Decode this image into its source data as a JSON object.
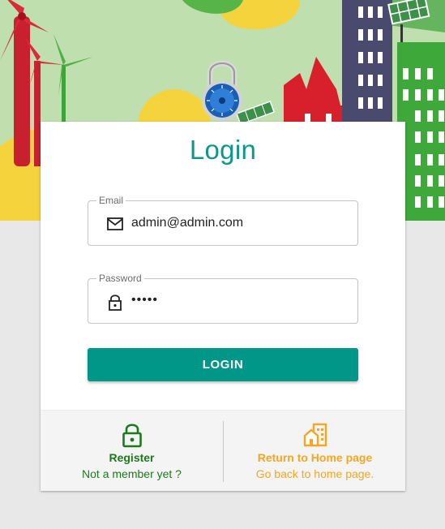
{
  "login_card": {
    "title": "Login",
    "email": {
      "label": "Email",
      "value": "admin@admin.com"
    },
    "password": {
      "label": "Password",
      "value": "•••••"
    },
    "submit_label": "LOGIN"
  },
  "footer": {
    "register": {
      "title": "Register",
      "subtitle": "Not a member yet ?"
    },
    "home": {
      "title": "Return to Home page",
      "subtitle": "Go back to home page."
    }
  },
  "icons": {
    "email": "envelope-icon",
    "password": "lock-icon",
    "register": "lock-icon",
    "home": "home-buildings-icon"
  },
  "colors": {
    "accent": "#009688",
    "title": "#0f968a",
    "register": "#1b7a1b",
    "home": "#f5a623",
    "banner_bg": "#c0dfae"
  }
}
